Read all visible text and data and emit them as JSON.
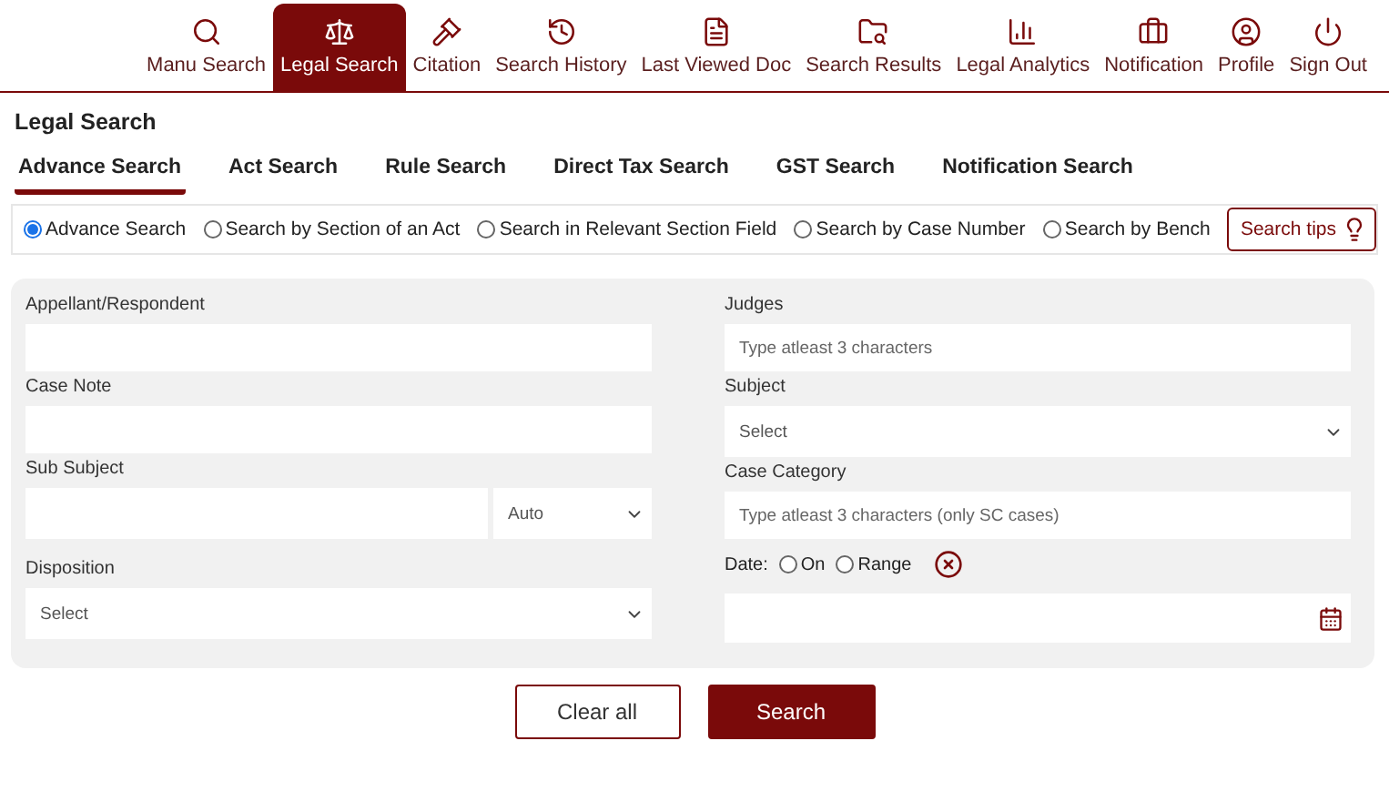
{
  "nav": [
    {
      "label": "Manu Search",
      "selected": false
    },
    {
      "label": "Legal Search",
      "selected": true
    },
    {
      "label": "Citation",
      "selected": false
    },
    {
      "label": "Search History",
      "selected": false
    },
    {
      "label": "Last Viewed Doc",
      "selected": false
    },
    {
      "label": "Search Results",
      "selected": false
    },
    {
      "label": "Legal Analytics",
      "selected": false
    },
    {
      "label": "Notification",
      "selected": false
    },
    {
      "label": "Profile",
      "selected": false
    },
    {
      "label": "Sign Out",
      "selected": false
    }
  ],
  "page_title": "Legal Search",
  "tabs": [
    {
      "label": "Advance Search",
      "selected": true
    },
    {
      "label": "Act Search",
      "selected": false
    },
    {
      "label": "Rule Search",
      "selected": false
    },
    {
      "label": "Direct Tax Search",
      "selected": false
    },
    {
      "label": "GST Search",
      "selected": false
    },
    {
      "label": "Notification Search",
      "selected": false
    }
  ],
  "search_modes": [
    {
      "label": "Advance Search",
      "selected": true
    },
    {
      "label": "Search by Section of an Act",
      "selected": false
    },
    {
      "label": "Search in Relevant Section Field",
      "selected": false
    },
    {
      "label": "Search by Case Number",
      "selected": false
    },
    {
      "label": "Search by Bench",
      "selected": false
    }
  ],
  "search_tips": "Search tips",
  "left_fields": [
    {
      "kind": "text",
      "label": "Appellant/Respondent"
    },
    {
      "kind": "text",
      "label": "Case Note"
    },
    {
      "kind": "text_select",
      "label": "Sub Subject",
      "value": "Auto"
    },
    {
      "kind": "select",
      "label": "Disposition",
      "value": "Select"
    }
  ],
  "right_fields": [
    {
      "kind": "text",
      "label": "Judges",
      "placeholder": "Type atleast 3 characters"
    },
    {
      "kind": "select",
      "label": "Subject",
      "value": "Select"
    },
    {
      "kind": "text",
      "label": "Case Category",
      "placeholder": "Type atleast 3 characters (only SC cases)"
    },
    {
      "kind": "date",
      "label": "Date:",
      "options": [
        {
          "label": "On",
          "selected": false
        },
        {
          "label": "Range",
          "selected": false
        }
      ]
    }
  ],
  "buttons": {
    "clear": "Clear all",
    "search": "Search"
  }
}
